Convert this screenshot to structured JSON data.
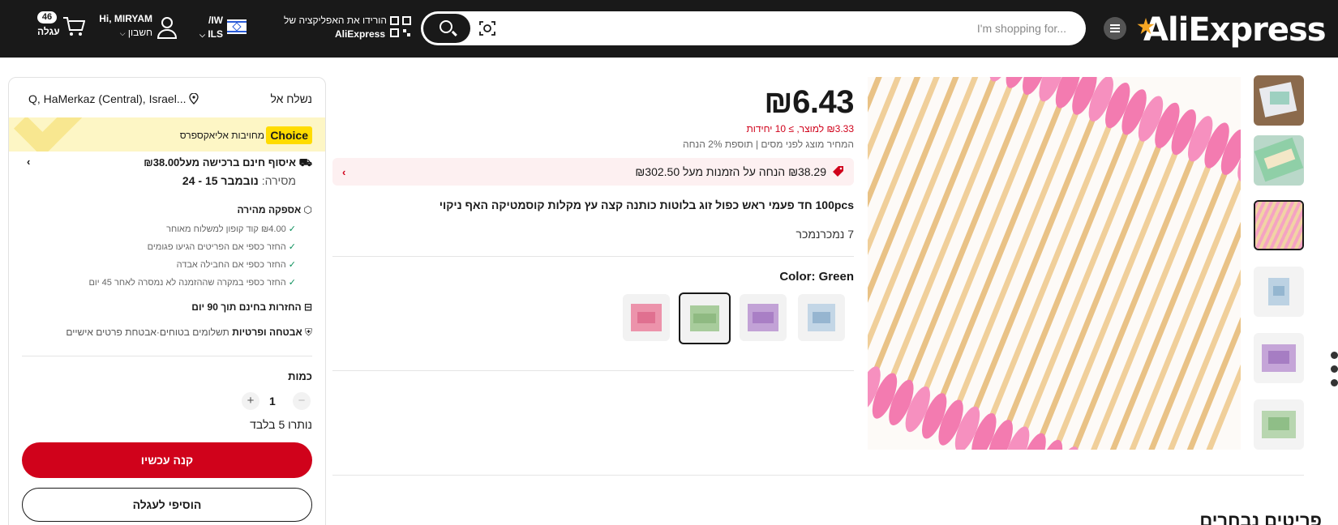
{
  "header": {
    "logo_text": "AliExpress",
    "search_placeholder": "I'm shopping for...",
    "app_promo_line1": "הורידו את האפליקציה של",
    "app_promo_line2": "AliExpress",
    "locale_line1": "/IW",
    "locale_line2": "ILS",
    "greeting": "Hi, MIRYAM",
    "account_label": "חשבון",
    "cart_label": "עגלה",
    "cart_count": "46"
  },
  "product": {
    "price": "₪6.43",
    "unit_price": "₪3.33 למוצר, ≥ 10 יחידות",
    "tax_note": "המחיר מוצג לפני מסים | תוספת 2% הנחה",
    "promo": "₪38.29 הנחה על הזמנות מעל ₪302.50",
    "title": "100pcs חד פעמי ראש כפול זוג בלוטות כותנה קצה עץ מקלות קוסמטיקה האף ניקוי",
    "sold": "7 נמכרנמכר",
    "color_label": "Color: Green",
    "variants": [
      "pink",
      "green",
      "purple",
      "blue"
    ],
    "selected_variant": "green"
  },
  "buybox": {
    "ship_to_label": "נשלח אל",
    "ship_to_value": "Q, HaMerkaz (Central), Israel...",
    "choice_badge": "Choice",
    "choice_text": "מחויבות אליאקספרס",
    "free_shipping": "איסוף חינם ברכישה מעל₪38.00",
    "delivery_label": "מסירה:",
    "delivery_dates": "נובמבר 15 - 24",
    "fast_delivery": "אספקה מהירה",
    "benefits": [
      "₪4.00 קוד קופון למשלוח מאוחר",
      "החזר כספי אם הפריטים הגיעו פגומים",
      "החזר כספי אם החבילה אבדה",
      "החזר כספי במקרה שההזמנה לא נמסרה לאחר 45 יום"
    ],
    "returns_text": "החזרות בחינם תוך 90 יום",
    "security_title": "אבטחה ופרטיות",
    "security_text": "תשלומים בטוחים·אבטחת פרטים אישיים",
    "quantity_label": "כמות",
    "quantity_value": "1",
    "stock_left": "נותרו 5 בלבד",
    "buy_now": "קנה עכשיו",
    "add_to_cart": "הוסיפי לעגלה"
  },
  "section": {
    "title": "פריטים נבחרים"
  },
  "colors": {
    "accent_red": "#d0021b",
    "choice_yellow": "#ffdc00",
    "header_bg": "#191919"
  }
}
